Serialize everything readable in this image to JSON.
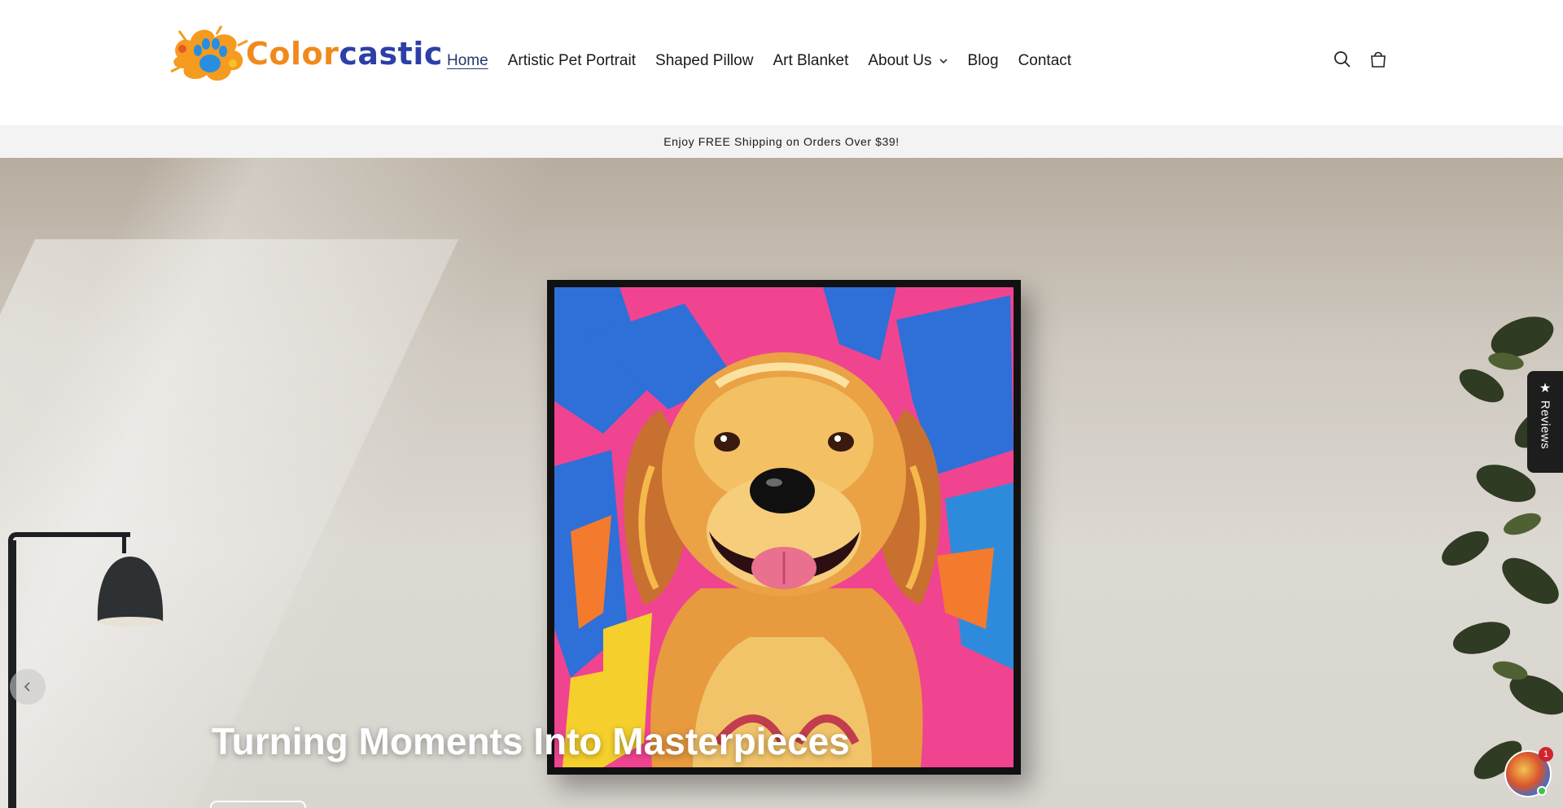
{
  "brand": {
    "name_part1": "Color",
    "name_part2": "castic",
    "primary_color": "#f08a1c",
    "secondary_color": "#2c3fa8"
  },
  "nav": {
    "items": [
      {
        "label": "Home",
        "active": true
      },
      {
        "label": "Artistic Pet Portrait"
      },
      {
        "label": "Shaped Pillow"
      },
      {
        "label": "Art Blanket"
      },
      {
        "label": "About Us",
        "has_dropdown": true
      },
      {
        "label": "Blog"
      },
      {
        "label": "Contact"
      }
    ]
  },
  "header_icons": [
    "search-icon",
    "cart-icon"
  ],
  "announcement": "Enjoy FREE Shipping on Orders Over $39!",
  "hero": {
    "title": "Turning Moments Into Masterpieces"
  },
  "reviews_tab": {
    "label": "Reviews",
    "icon": "star-icon"
  },
  "chat": {
    "badge_count": "1"
  }
}
